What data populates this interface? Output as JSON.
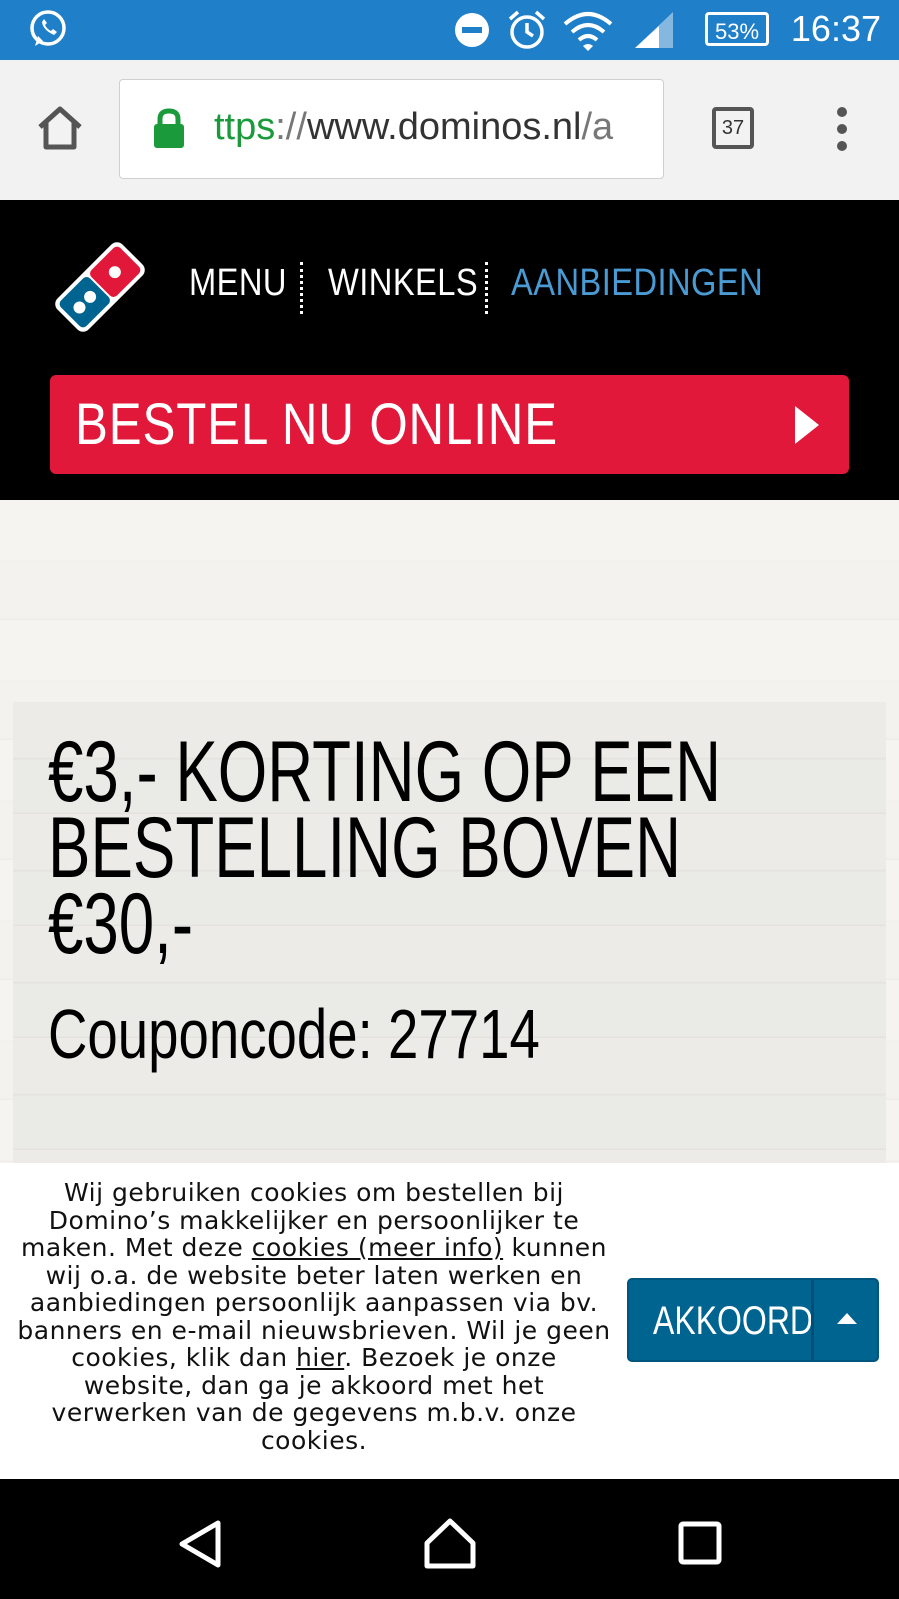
{
  "status_bar": {
    "battery": "53%",
    "time": "16:37",
    "icons": [
      "whatsapp-icon",
      "do-not-disturb-icon",
      "alarm-icon",
      "wifi-icon",
      "signal-icon",
      "battery-icon"
    ]
  },
  "browser": {
    "url_scheme": "ttps",
    "url_sep": "://",
    "url_host": "www.dominos.nl",
    "url_path": "/a",
    "tab_count": "37"
  },
  "header": {
    "nav": [
      "MENU",
      "WINKELS",
      "AANBIEDINGEN"
    ],
    "order_button": "BESTEL NU ONLINE"
  },
  "promo": {
    "title": "€3,- KORTING OP EEN\nBESTELLING BOVEN €30,-",
    "coupon": "Couponcode: 27714"
  },
  "cookie": {
    "text_before": "Wij gebruiken cookies om bestellen bij Domino’s makkelijker en persoonlijker te maken. Met deze ",
    "link_more": "cookies (meer info)",
    "text_middle": " kunnen wij o.a. de website beter laten werken en aanbiedingen persoonlijk aanpassen via bv. banners en e-mail nieuwsbrieven. Wil je geen cookies, klik dan ",
    "link_here": "hier",
    "text_after": ". Bezoek je onze website, dan ga je akkoord met het verwerken van de gegevens m.b.v. onze cookies.",
    "accept_button": "AKKOORD"
  },
  "colors": {
    "status_bar": "#1f7fc8",
    "brand_red": "#e2183a",
    "brand_blue": "#006491",
    "nav_active": "#4a9ad4"
  }
}
